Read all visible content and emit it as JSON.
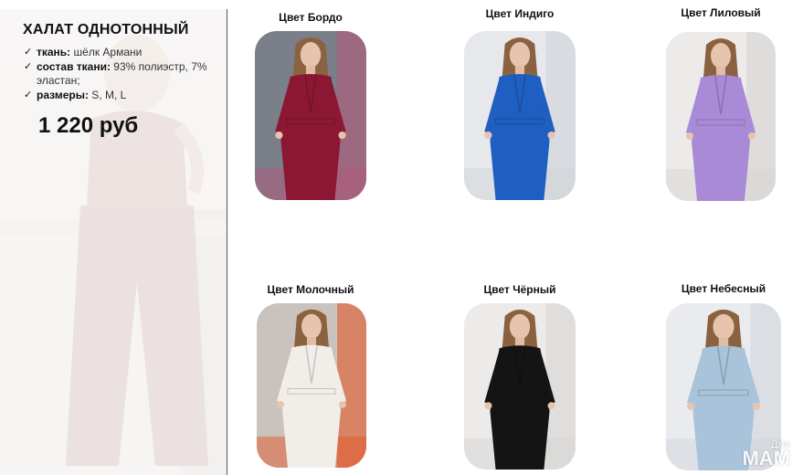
{
  "product": {
    "title": "ХАЛАТ ОДНОТОННЫЙ",
    "specs": [
      {
        "label": "ткань:",
        "value": " шёлк Армани"
      },
      {
        "label": "состав ткани:",
        "value": " 93% полиэстр, 7% эластан;"
      },
      {
        "label": "размеры:",
        "value": " S, M, L"
      }
    ],
    "price": "1 220 руб"
  },
  "variants": [
    {
      "caption": "Цвет Бордо",
      "color": "#8c1733",
      "bg": "#7a7f8a",
      "accent": "#b35a7a"
    },
    {
      "caption": "Цвет Индиго",
      "color": "#1f5fc2",
      "bg": "#e6e8ec",
      "accent": "#cfd3d9"
    },
    {
      "caption": "Цвет Лиловый",
      "color": "#a98ad6",
      "bg": "#ecebea",
      "accent": "#d7d4d2"
    },
    {
      "caption": "Цвет Молочный",
      "color": "#f1eeea",
      "bg": "#c9c2bd",
      "accent": "#e2572c"
    },
    {
      "caption": "Цвет Чёрный",
      "color": "#141414",
      "bg": "#ecebea",
      "accent": "#d8d6d3"
    },
    {
      "caption": "Цвет Небесный",
      "color": "#a9c3da",
      "bg": "#e9ebee",
      "accent": "#d2d6dc"
    }
  ],
  "watermark": {
    "top": "Для",
    "bottom": "МАМ"
  }
}
